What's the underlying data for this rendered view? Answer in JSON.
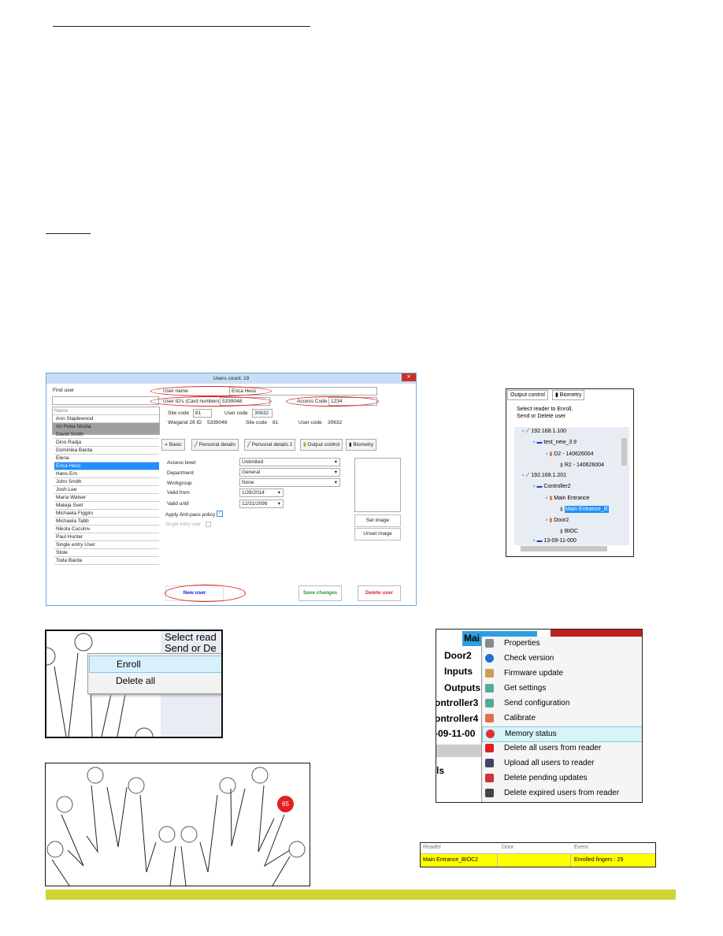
{
  "dialog": {
    "title": "Users count: 19",
    "find_user_label": "Find user",
    "user_name_label": "User name",
    "user_name": "Erica Hess",
    "user_ids_label": "User ID's (Card numbers)",
    "user_ids": "5339048",
    "access_code_label": "Access Code",
    "access_code": "1234",
    "site_code_label": "Site code",
    "site_code": "81",
    "user_code_label": "User code",
    "user_code": "30632",
    "wiegand_label": "Wiegand 26  ID",
    "wiegand_id": "5339048",
    "wiegand_site_label": "Site code",
    "wiegand_site": "81",
    "wiegand_user_label": "User code",
    "wiegand_user": "30632",
    "list_header": "Name",
    "users": [
      "Ann Staplewood",
      "Ari Peka Nicola",
      "David Smith",
      "Dino Radja",
      "Dominika Barda",
      "Elena",
      "Erica Hess",
      "Hans Ern",
      "John Smith",
      "Josh Lee",
      "Maria Walser",
      "Mateja Svet",
      "Michaela Figgini",
      "Michaela Tabb",
      "Nikola Cuculov",
      "Paul Hunter",
      "Single entry User",
      "Stole",
      "Toda Barda"
    ],
    "selected_user": "Erica Hess",
    "tabs": [
      "Basic",
      "Personal details",
      "Personal details 2",
      "Output control",
      "Biometry"
    ],
    "fields": {
      "access_level_label": "Access level",
      "access_level": "Unlimited",
      "department_label": "Department",
      "department": "General",
      "workgroup_label": "Workgroup",
      "workgroup": "None",
      "valid_from_label": "Valid from",
      "valid_from": "1/28/2014",
      "valid_until_label": "Valid until",
      "valid_until": "12/31/2099",
      "anti_pass_label": "Apply Anti-pass policy",
      "anti_pass_checked": true,
      "single_entry_label": "Single entry user",
      "single_entry_checked": false
    },
    "set_image": "Set image",
    "unset_image": "Unset image",
    "new_user": "New user",
    "save_changes": "Save changes",
    "delete_user": "Delete user",
    "colors": {
      "save": "#2a9a2a",
      "delete": "#e02020",
      "new": "#1a1ad0",
      "highlight": "#d22222"
    }
  },
  "tree": {
    "tabs": [
      "Output control",
      "Biometry"
    ],
    "instruction_1": "Select reader to Enroll,",
    "instruction_2": "Send or Delete user",
    "nodes": [
      "192.168.1.100",
      "test_new_3.9",
      "D2 - 140626004",
      "R2 - 140626004",
      "192.168.1.201",
      "Controller2",
      "Main Entrance",
      "Main Entrance_B",
      "Door2",
      "BIOC",
      "13-09-11-000"
    ]
  },
  "enroll_menu": {
    "bg_1": "Select read",
    "bg_2": "Send or De",
    "items": [
      "Enroll",
      "Delete all"
    ]
  },
  "fingers": {
    "badge": "65",
    "badge_color": "#e02020"
  },
  "context_menu": {
    "bg_items": [
      "Mai",
      "Door2",
      "Inputs",
      "Outputs",
      "ontroller3",
      "ontroller4",
      "-09-11-00",
      "ls"
    ],
    "items": [
      "Properties",
      "Check version",
      "Firmware update",
      "Get settings",
      "Send configuration",
      "Calibrate",
      "Memory status",
      "Delete all users from reader",
      "Upload all users to reader",
      "Delete pending updates",
      "Delete expired users from reader"
    ],
    "highlighted": "Memory status"
  },
  "event_table": {
    "headers": [
      "Reader",
      "Door",
      "Event"
    ],
    "row": [
      "Main Entrance_BIOC2",
      "",
      "Enrolled fingers : 29"
    ],
    "row_color": "#ffff00"
  },
  "footer_color": "#cfd334"
}
